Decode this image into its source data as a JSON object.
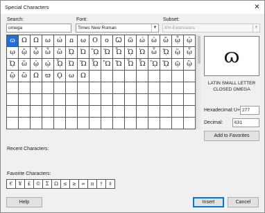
{
  "window": {
    "title": "Special Characters",
    "close_glyph": "✕"
  },
  "search": {
    "label": "Search:",
    "value": "omega"
  },
  "font": {
    "label": "Font:",
    "value": "Times New Roman"
  },
  "subset": {
    "label": "Subset:",
    "value": "IPA Extensions"
  },
  "characters": [
    "ɷ",
    "Ω",
    "Ω",
    "ω",
    "ώ",
    "ꭥ",
    "ω",
    "Ο",
    "ο",
    "Ꞷ",
    "ῶ",
    "ώ",
    "ὠ",
    "ὤ",
    "ᾦ",
    "ᾠ",
    "ῳ",
    "ᾤ",
    "ᾦ",
    "ὦ",
    "ὢ",
    "ᾨ",
    "Ὠ",
    "ᾪ",
    "Ὥ",
    "Ὦ",
    "ᾩ",
    "Ὡ",
    "ὧ",
    "ᾬ",
    "ᾥ",
    "ᾧ",
    "ᾨ",
    "ὥ",
    "ᾡ",
    "ῴ",
    "ᾮ",
    "Ὠ",
    "Ὥ",
    "ᾯ",
    "Ὢ",
    "Ὤ",
    "Ὦ",
    "Ὧ",
    "ᾫ",
    "ᾭ",
    "ῷ",
    "ᾣ",
    "ᾢ",
    "ὣ",
    "Ω",
    "ϖ",
    "Ϙ",
    "ω",
    "Ω",
    "",
    "",
    "",
    "",
    "",
    "",
    "",
    "",
    "",
    "",
    "",
    "",
    "",
    "",
    "",
    "",
    "",
    "",
    "",
    "",
    "",
    "",
    "",
    "",
    "",
    "",
    "",
    "",
    "",
    "",
    "",
    "",
    "",
    "",
    "",
    "",
    "",
    "",
    "",
    "",
    "",
    "",
    "",
    "",
    "",
    "",
    "",
    "",
    "",
    "",
    "",
    "",
    "",
    "",
    "",
    "",
    "",
    "",
    "",
    "",
    "",
    "",
    "",
    "",
    "",
    "",
    "",
    "",
    "",
    "",
    "",
    "",
    ""
  ],
  "selected": {
    "glyph": "ɷ",
    "name": "LATIN SMALL LETTER CLOSED OMEGA",
    "hex_label": "Hexadecimal:",
    "hex_prefix": "U+",
    "hex_value": "277",
    "dec_label": "Decimal:",
    "dec_value": "631"
  },
  "add_favorites_label": "Add to Favorites",
  "recent_label": "Recent Characters:",
  "favorites_label": "Favorite Characters:",
  "favorites": [
    "€",
    "¥",
    "£",
    "©",
    "Σ",
    "Ω",
    "≤",
    "≥",
    "∞",
    "π",
    "†",
    "‡"
  ],
  "buttons": {
    "help": "Help",
    "insert": "Insert",
    "cancel": "Cancel"
  }
}
